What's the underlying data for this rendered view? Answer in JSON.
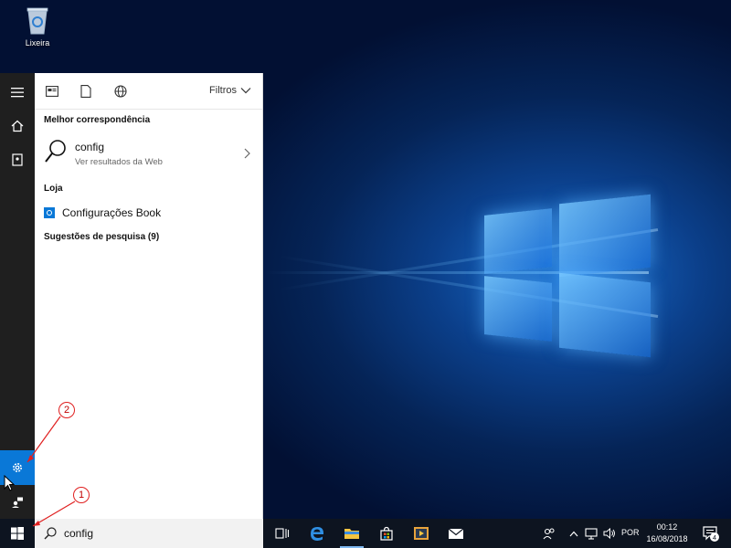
{
  "desktop": {
    "recycle_bin_label": "Lixeira"
  },
  "search_panel": {
    "filters_label": "Filtros",
    "best_match_heading": "Melhor correspondência",
    "best_match": {
      "title": "config",
      "subtitle": "Ver resultados da Web"
    },
    "store_heading": "Loja",
    "store_item": "Configurações Book",
    "suggestions_heading": "Sugestões de pesquisa (9)"
  },
  "taskbar": {
    "search_value": "config",
    "language": "POR",
    "time": "00:12",
    "date": "16/08/2018",
    "notification_count": "4"
  },
  "annotations": {
    "callout_1": "1",
    "callout_2": "2"
  },
  "colors": {
    "accent": "#0a78d7",
    "annotation": "#e02020"
  }
}
